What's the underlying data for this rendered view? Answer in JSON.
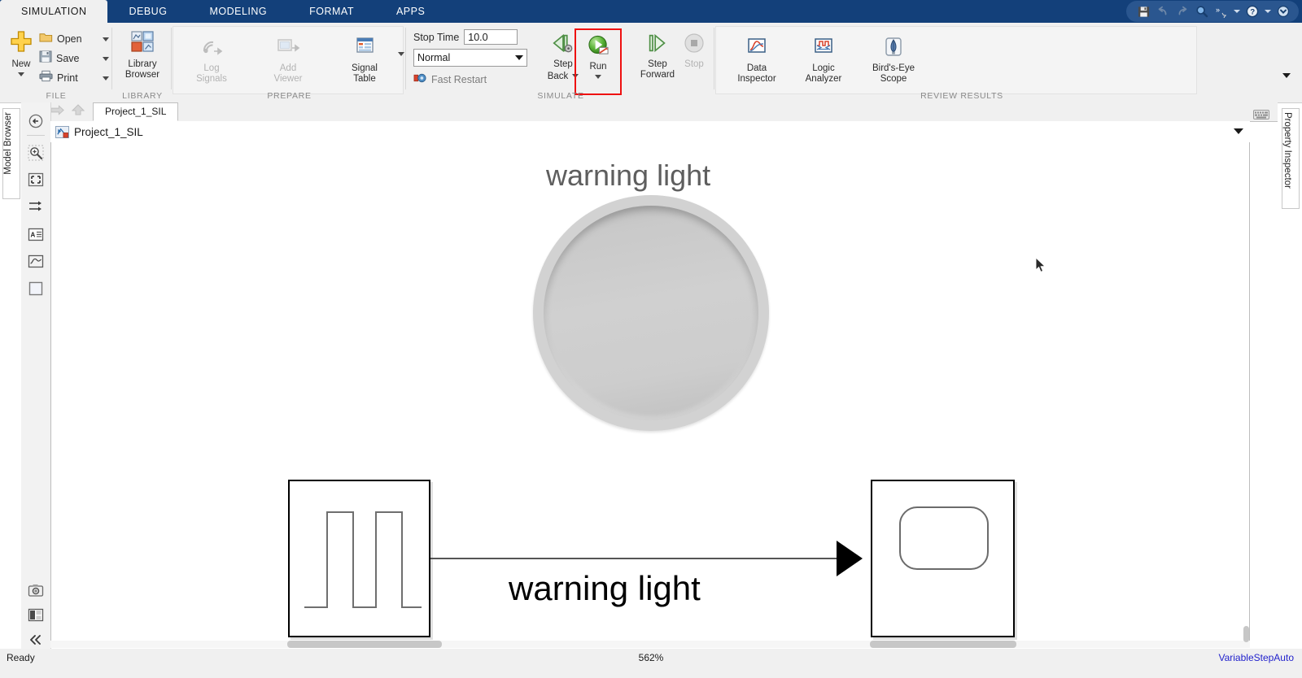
{
  "window": {
    "ribbon_tabs": [
      {
        "label": "SIMULATION",
        "active": true
      },
      {
        "label": "DEBUG",
        "active": false
      },
      {
        "label": "MODELING",
        "active": false
      },
      {
        "label": "FORMAT",
        "active": false
      },
      {
        "label": "APPS",
        "active": false
      }
    ],
    "quick_access": [
      {
        "name": "save-icon",
        "glyph": "save"
      },
      {
        "name": "undo-icon",
        "glyph": "undo"
      },
      {
        "name": "redo-icon",
        "glyph": "redo"
      },
      {
        "name": "search-icon",
        "glyph": "search"
      },
      {
        "name": "favorites-icon",
        "glyph": "favorites"
      },
      {
        "name": "help-icon",
        "glyph": "help"
      },
      {
        "name": "minimize-ribbon-icon",
        "glyph": "chevron-circle"
      }
    ]
  },
  "ribbon": {
    "groups": [
      {
        "name": "file",
        "label": "FILE"
      },
      {
        "name": "library",
        "label": "LIBRARY"
      },
      {
        "name": "prepare",
        "label": "PREPARE"
      },
      {
        "name": "simulate",
        "label": "SIMULATE"
      },
      {
        "name": "review_results",
        "label": "REVIEW RESULTS"
      }
    ],
    "file": {
      "new_label": "New",
      "open_label": "Open",
      "save_label": "Save",
      "print_label": "Print"
    },
    "library": {
      "library_browser_line1": "Library",
      "library_browser_line2": "Browser"
    },
    "prepare": {
      "log_signals_line1": "Log",
      "log_signals_line2": "Signals",
      "add_viewer_line1": "Add",
      "add_viewer_line2": "Viewer",
      "signal_table_line1": "Signal",
      "signal_table_line2": "Table"
    },
    "simulate": {
      "stop_time_label": "Stop Time",
      "stop_time_value": "10.0",
      "sim_mode_value": "Normal",
      "fast_restart_label": "Fast Restart",
      "step_back_line1": "Step",
      "step_back_line2": "Back",
      "run_label": "Run",
      "step_forward_line1": "Step",
      "step_forward_line2": "Forward",
      "stop_label": "Stop",
      "run_highlight_color": "#ee1111"
    },
    "review": {
      "data_inspector_line1": "Data",
      "data_inspector_line2": "Inspector",
      "logic_analyzer_line1": "Logic",
      "logic_analyzer_line2": "Analyzer",
      "birdseye_line1": "Bird's-Eye",
      "birdseye_line2": "Scope"
    }
  },
  "document": {
    "tab_label": "Project_1_SIL",
    "breadcrumb": "Project_1_SIL"
  },
  "panels": {
    "model_browser_label": "Model Browser",
    "property_inspector_label": "Property Inspector"
  },
  "left_rail_icons": [
    {
      "name": "back-to-parent-icon"
    },
    {
      "name": "zoom-in-region-icon"
    },
    {
      "name": "fit-to-view-icon"
    },
    {
      "name": "signal-routing-icon"
    },
    {
      "name": "annotation-icon"
    },
    {
      "name": "scope-preview-icon"
    },
    {
      "name": "block-shape-icon"
    },
    {
      "name": "camera-snapshot-icon"
    },
    {
      "name": "layout-panels-icon"
    },
    {
      "name": "collapse-rail-icon"
    }
  ],
  "canvas": {
    "lamp_title": "warning light",
    "signal_label": "warning light",
    "source_block_name": "pulse-generator-block",
    "sink_block_name": "lamp-display-block"
  },
  "status": {
    "ready_text": "Ready",
    "zoom_text": "562%",
    "solver_text": "VariableStepAuto",
    "solver_color": "#2222cc"
  }
}
